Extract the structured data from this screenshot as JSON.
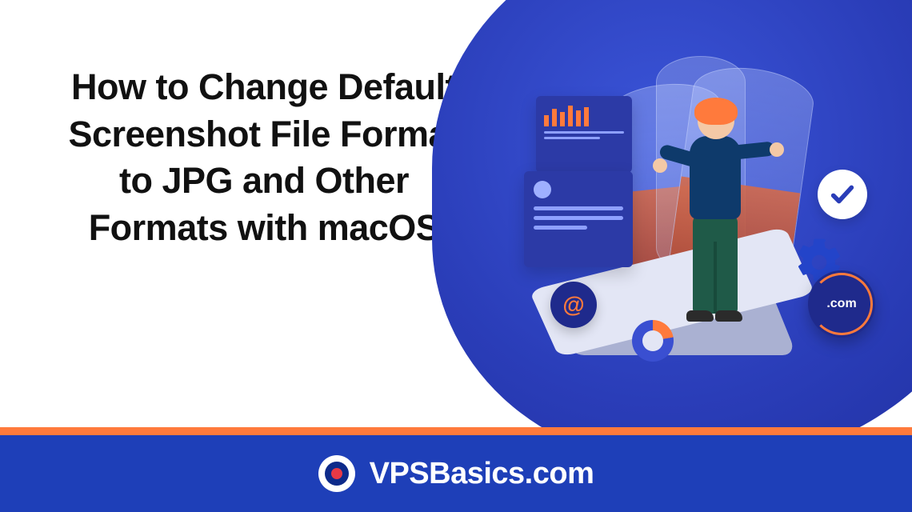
{
  "hero": {
    "title": "How to Change Default Screenshot File Format to JPG and Other Formats with macOS"
  },
  "illustration": {
    "badges": {
      "at_symbol": "@",
      "checkmark": "✓",
      "com_label": ".com"
    },
    "icons": {
      "stats_card": "bar-chart-card",
      "profile_card": "profile-card",
      "gear": "gear-icon",
      "donut": "donut-chart-icon",
      "person": "standing-person-illustration"
    }
  },
  "footer": {
    "brand": "VPSBasics.com",
    "logo_name": "vpsbasics-target-logo"
  },
  "colors": {
    "accent_orange": "#ff7a3c",
    "primary_blue": "#1e3fb8",
    "deep_blue": "#2a3db8"
  }
}
